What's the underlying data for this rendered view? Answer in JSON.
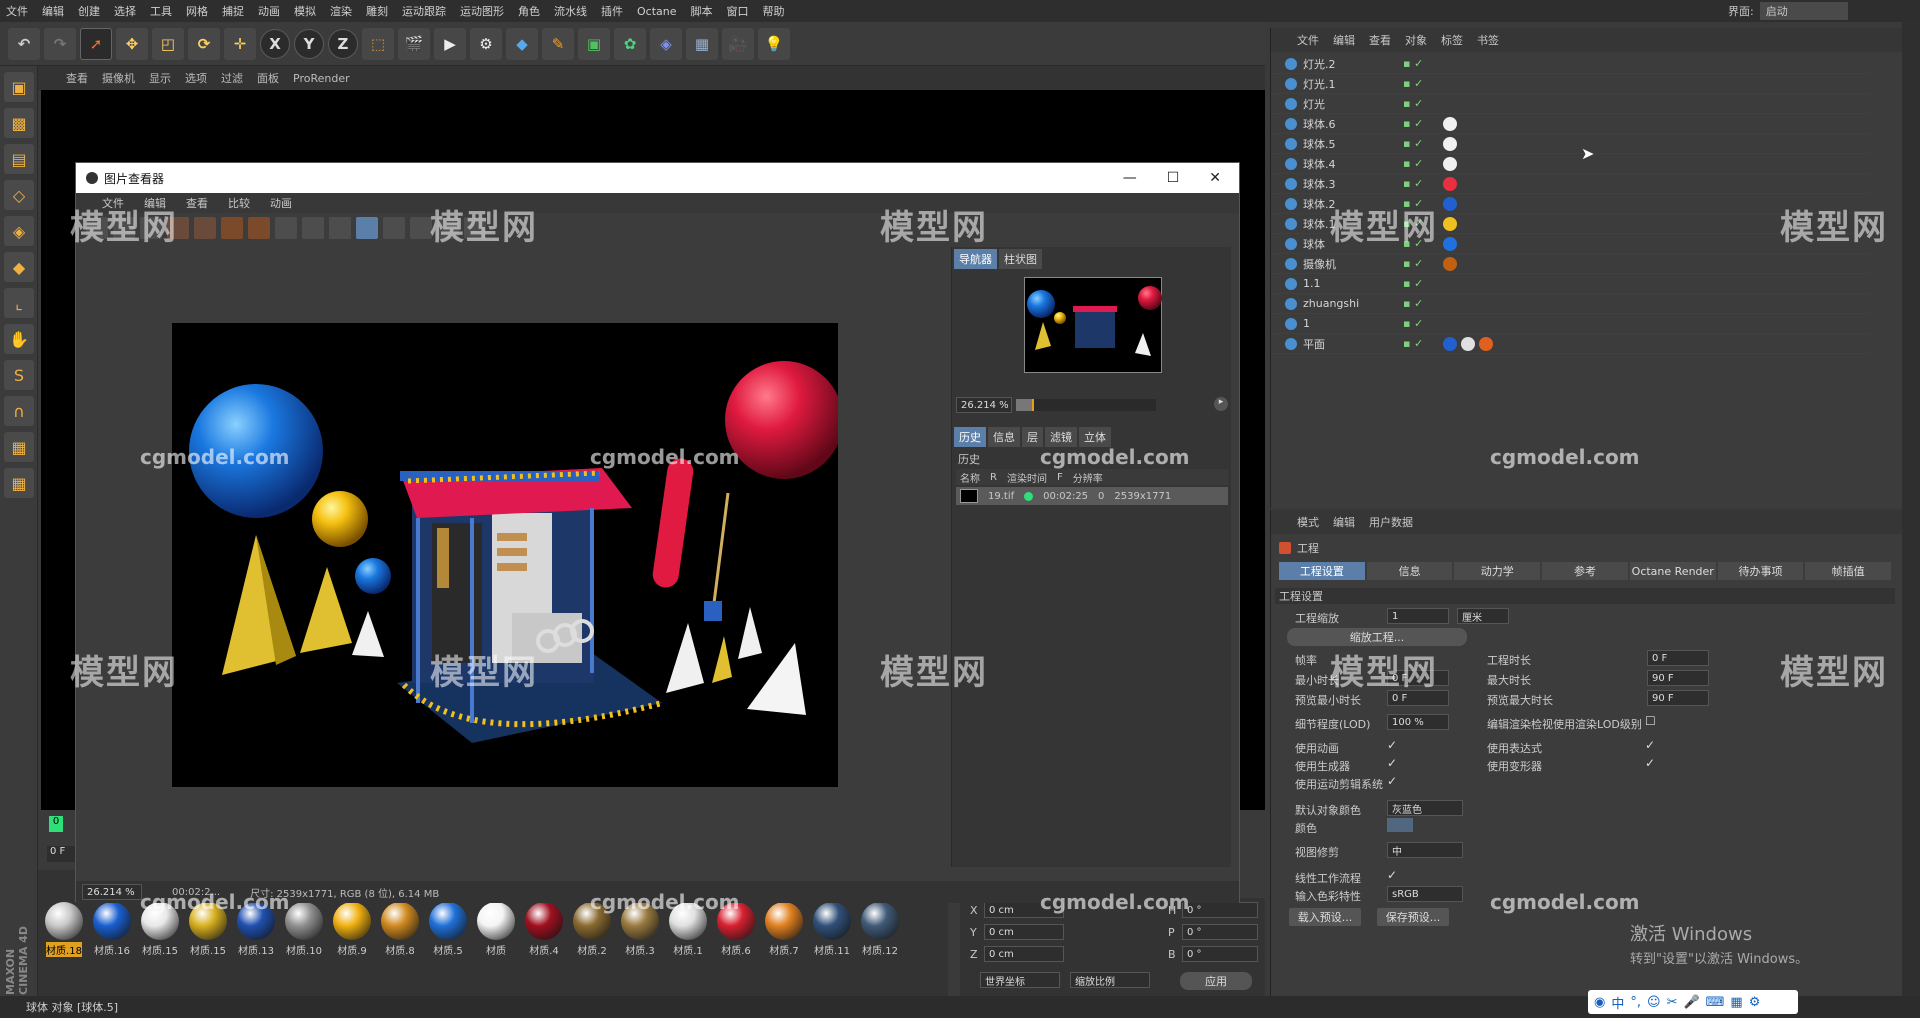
{
  "menubar": [
    "文件",
    "编辑",
    "创建",
    "选择",
    "工具",
    "网格",
    "捕捉",
    "动画",
    "模拟",
    "渲染",
    "雕刻",
    "运动跟踪",
    "运动图形",
    "角色",
    "流水线",
    "插件",
    "Octane",
    "脚本",
    "窗口",
    "帮助"
  ],
  "interface": {
    "label": "界面:",
    "value": "启动"
  },
  "toolbar": {
    "x": "X",
    "y": "Y",
    "z": "Z"
  },
  "viewport_menu": [
    "查看",
    "摄像机",
    "显示",
    "选项",
    "过滤",
    "面板",
    "ProRender"
  ],
  "picture_viewer": {
    "title": "图片查看器",
    "menu": [
      "文件",
      "编辑",
      "查看",
      "比较",
      "动画"
    ],
    "tabs_top": [
      "导航器",
      "柱状图"
    ],
    "zoom": "26.214 %",
    "tabs_bottom": [
      "历史",
      "信息",
      "层",
      "滤镜",
      "立体"
    ],
    "history_label": "历史",
    "columns": [
      "名称",
      "R",
      "渲染时间",
      "F",
      "分辨率"
    ],
    "row": {
      "name": "19.tif",
      "time": "00:02:25",
      "frame": "0",
      "res": "2539x1771"
    },
    "status": {
      "zoom": "26.214 %",
      "time": "00:02:2...",
      "info": "尺寸: 2539x1771, RGB (8 位), 6.14 MB"
    }
  },
  "object_manager": {
    "menu": [
      "文件",
      "编辑",
      "查看",
      "对象",
      "标签",
      "书签"
    ],
    "objects": [
      {
        "name": "灯光.2",
        "tags": []
      },
      {
        "name": "灯光.1",
        "tags": []
      },
      {
        "name": "灯光",
        "tags": []
      },
      {
        "name": "球体.6",
        "tags": [
          "#f0f0f0"
        ]
      },
      {
        "name": "球体.5",
        "tags": [
          "#f0f0f0"
        ]
      },
      {
        "name": "球体.4",
        "tags": [
          "#f0f0f0"
        ]
      },
      {
        "name": "球体.3",
        "tags": [
          "#e83040"
        ]
      },
      {
        "name": "球体.2",
        "tags": [
          "#2060d0"
        ]
      },
      {
        "name": "球体.1",
        "tags": [
          "#f0c020"
        ]
      },
      {
        "name": "球体",
        "tags": [
          "#2070e0"
        ]
      },
      {
        "name": "摄像机",
        "tags": [
          "#c06010"
        ]
      },
      {
        "name": "1.1",
        "tags": []
      },
      {
        "name": "zhuangshi",
        "tags": []
      },
      {
        "name": "1",
        "tags": []
      },
      {
        "name": "平面",
        "tags": [
          "#2060d0",
          "#e0e0e0",
          "#e06020"
        ]
      }
    ]
  },
  "attributes": {
    "menu": [
      "模式",
      "编辑",
      "用户数据"
    ],
    "header": "工程",
    "tabs": [
      "工程设置",
      "信息",
      "动力学",
      "参考",
      "Octane Render",
      "待办事项",
      "帧插值"
    ],
    "section": "工程设置",
    "scale_label": "工程缩放",
    "scale_value": "1",
    "scale_unit": "厘米",
    "scale_button": "缩放工程...",
    "fps_label": "帧率",
    "duration_label": "工程时长",
    "duration_value": "0 F",
    "min_label": "最小时长",
    "min_value": "0 F",
    "max_label": "最大时长",
    "max_value": "90 F",
    "pmin_label": "预览最小时长",
    "pmin_value": "0 F",
    "pmax_label": "预览最大时长",
    "pmax_value": "90 F",
    "lod_label": "细节程度(LOD)",
    "lod_value": "100 %",
    "lod_render_label": "编辑渲染检视使用渲染LOD级别",
    "anim_label": "使用动画",
    "expr_label": "使用表达式",
    "gen_label": "使用生成器",
    "deform_label": "使用变形器",
    "motion_label": "使用运动剪辑系统",
    "defcolor_label": "默认对象颜色",
    "defcolor_value": "灰蓝色",
    "color_label": "颜色",
    "clip_label": "视图修剪",
    "clip_value": "中",
    "linear_label": "线性工作流程",
    "profile_label": "输入色彩特性",
    "profile_value": "sRGB",
    "load_btn": "载入预设...",
    "save_btn": "保存预设..."
  },
  "timeline": {
    "frame_start": "0",
    "frame_current": "0 F"
  },
  "coords": {
    "x": "0 cm",
    "y": "0 cm",
    "z": "0 cm",
    "h": "0 °",
    "p": "0 °",
    "b": "0 °",
    "world": "世界坐标",
    "scale": "缩放比例",
    "apply": "应用"
  },
  "materials": [
    {
      "name": "材质.18",
      "color": "#c8c8c8"
    },
    {
      "name": "材质.16",
      "color": "#1a5fd0"
    },
    {
      "name": "材质.15",
      "color": "#e8e8e8"
    },
    {
      "name": "材质.15",
      "color": "#d8b020"
    },
    {
      "name": "材质.13",
      "color": "#2050b0"
    },
    {
      "name": "材质.10",
      "color": "#909090"
    },
    {
      "name": "材质.9",
      "color": "#f0b010"
    },
    {
      "name": "材质.8",
      "color": "#d08a20"
    },
    {
      "name": "材质.5",
      "color": "#2070d8"
    },
    {
      "name": "材质",
      "color": "#f4f4f4"
    },
    {
      "name": "材质.4",
      "color": "#a01020"
    },
    {
      "name": "材质.2",
      "color": "#8a6a30"
    },
    {
      "name": "材质.3",
      "color": "#9a7a40"
    },
    {
      "name": "材质.1",
      "color": "#e0e0e0"
    },
    {
      "name": "材质.6",
      "color": "#d82030"
    },
    {
      "name": "材质.7",
      "color": "#e08020"
    },
    {
      "name": "材质.11",
      "color": "#305078"
    },
    {
      "name": "材质.12",
      "color": "#405a78"
    }
  ],
  "status": "球体 对象 [球体.5]",
  "watermarks": {
    "cg": "cgmodel.com",
    "mx": "模型网"
  },
  "windows": {
    "line1": "激活 Windows",
    "line2": "转到\"设置\"以激活 Windows。"
  },
  "ime": "中"
}
